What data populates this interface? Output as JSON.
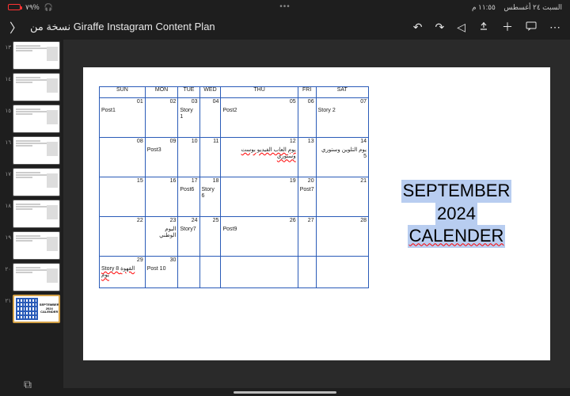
{
  "statusbar": {
    "time": "١١:٥٥ م",
    "date": "السبت ٢٤ أغسطس",
    "signal": "٧٩%"
  },
  "header": {
    "title": "نسخة من Giraffe Instagram Content Plan"
  },
  "thumbs": [
    {
      "n": "١٣"
    },
    {
      "n": "١٤"
    },
    {
      "n": "١٥"
    },
    {
      "n": "١٦"
    },
    {
      "n": "١٧"
    },
    {
      "n": "١٨"
    },
    {
      "n": "١٩"
    },
    {
      "n": "٢٠"
    },
    {
      "n": "٢١"
    }
  ],
  "slide": {
    "title1": "SEPTEMBER",
    "title2": "2024",
    "title3": "CALENDER",
    "days": [
      "SUN",
      "MON",
      "TUE",
      "WED",
      "THU",
      "FRI",
      "SAT"
    ],
    "weeks": [
      [
        {
          "d": "01",
          "t": "Post1"
        },
        {
          "d": "02",
          "t": ""
        },
        {
          "d": "03",
          "t": "Story 1"
        },
        {
          "d": "04",
          "t": ""
        },
        {
          "d": "05",
          "t": "Post2"
        },
        {
          "d": "06",
          "t": ""
        },
        {
          "d": "07",
          "t": "Story 2"
        }
      ],
      [
        {
          "d": "08",
          "t": ""
        },
        {
          "d": "09",
          "t": "Post3"
        },
        {
          "d": "10",
          "t": ""
        },
        {
          "d": "11",
          "t": ""
        },
        {
          "d": "12",
          "t": "يوم العاب الفيديو بوست وستوري",
          "ar": true,
          "red": true
        },
        {
          "d": "13",
          "t": ""
        },
        {
          "d": "14",
          "t": "يوم التلوين وستوري 5",
          "ar": true
        }
      ],
      [
        {
          "d": "15",
          "t": ""
        },
        {
          "d": "16",
          "t": ""
        },
        {
          "d": "17",
          "t": "Post6"
        },
        {
          "d": "18",
          "t": "Story 6"
        },
        {
          "d": "19",
          "t": ""
        },
        {
          "d": "20",
          "t": "Post7"
        },
        {
          "d": "21",
          "t": ""
        }
      ],
      [
        {
          "d": "22",
          "t": ""
        },
        {
          "d": "23",
          "t": "اليوم الوطني",
          "ar": true
        },
        {
          "d": "24",
          "t": "Story7"
        },
        {
          "d": "25",
          "t": ""
        },
        {
          "d": "26",
          "t": "Post9"
        },
        {
          "d": "27",
          "t": ""
        },
        {
          "d": "28",
          "t": ""
        }
      ],
      [
        {
          "d": "29",
          "t": "Story 8 القهوة يوم",
          "red": true
        },
        {
          "d": "30",
          "t": "Post 10"
        },
        {
          "d": "",
          "t": "",
          "empty": true
        },
        {
          "d": "",
          "t": "",
          "empty": true
        },
        {
          "d": "",
          "t": "",
          "empty": true
        },
        {
          "d": "",
          "t": "",
          "empty": true
        },
        {
          "d": "",
          "t": "",
          "empty": true
        }
      ]
    ]
  }
}
